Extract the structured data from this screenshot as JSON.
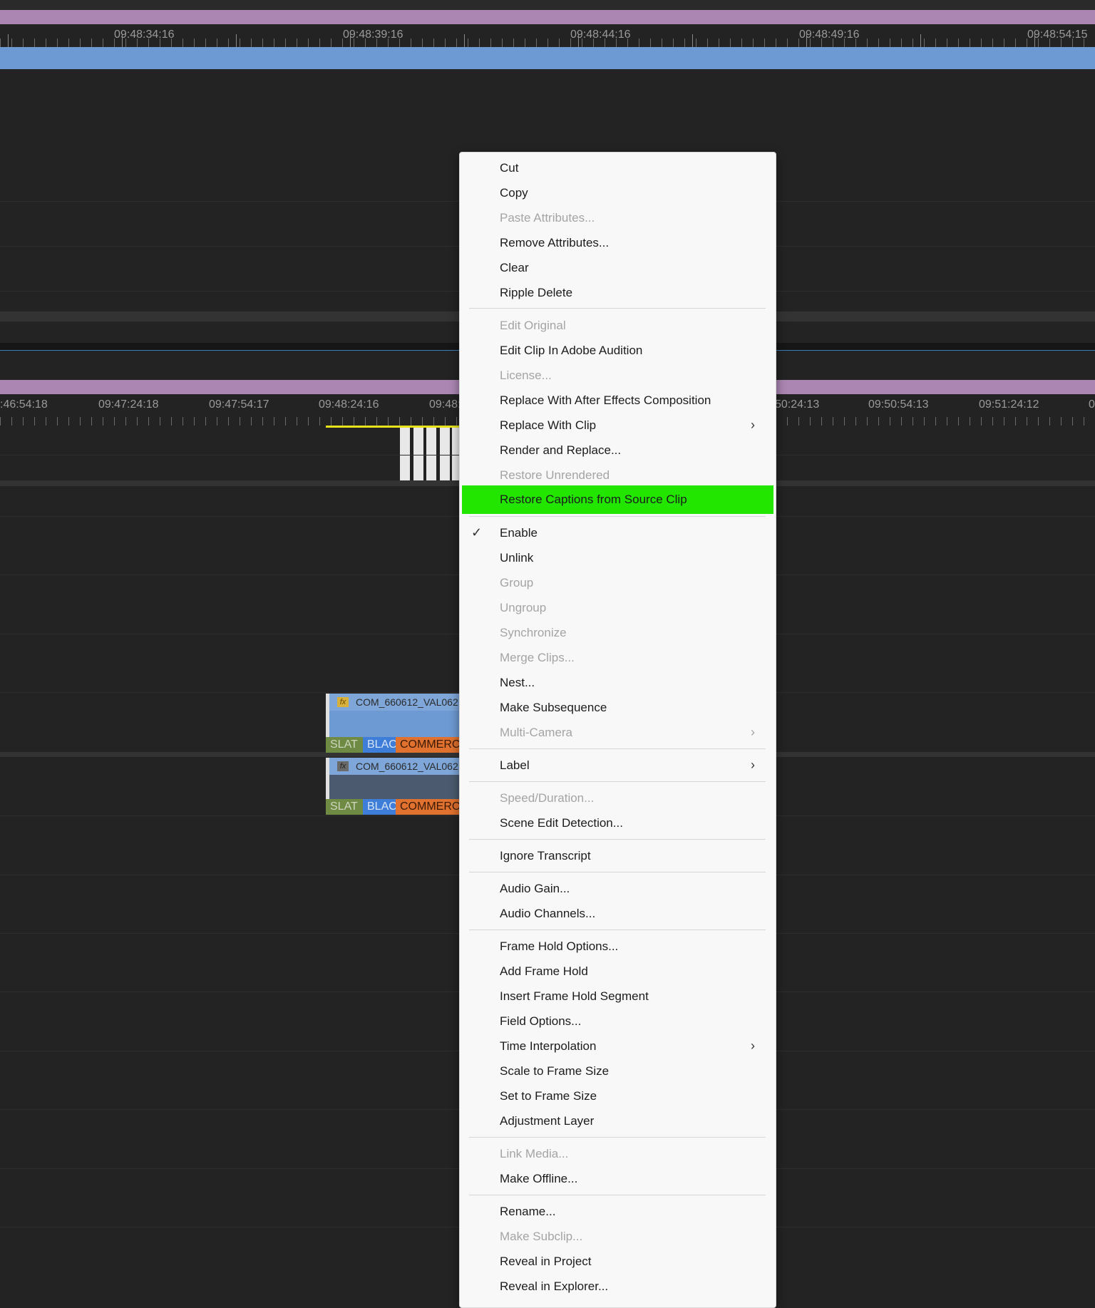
{
  "timeline_top": {
    "timecodes": [
      "09:48:34:16",
      "09:48:39:16",
      "09:48:44:16",
      "09:48:49:16",
      "09:48:54:15"
    ]
  },
  "timeline_bottom": {
    "timecodes": [
      ":46:54:18",
      "09:47:24:18",
      "09:47:54:17",
      "09:48:24:16",
      "09:48:",
      "50:24:13",
      "09:50:54:13",
      "09:51:24:12",
      "0"
    ]
  },
  "clips": {
    "video": {
      "fx_label": "fx",
      "name": "COM_660612_VAL062",
      "markers": [
        "SLAT",
        "BLAC",
        "COMMERC"
      ]
    },
    "audio": {
      "fx_label": "fx",
      "name": "COM_660612_VAL062",
      "markers": [
        "SLAT",
        "BLAC",
        "COMMERC"
      ]
    }
  },
  "colors": {
    "highlight": "#22e500",
    "purple_bar": "#ab86b2",
    "blue_bar": "#6d9ad2",
    "marker_green": "#6e8a43",
    "marker_blue": "#3f7ed8",
    "marker_orange": "#e0712e"
  },
  "menu": {
    "check_icon": "checkmark-icon",
    "submenu_icon": "chevron-right-icon",
    "items": [
      {
        "label": "Cut"
      },
      {
        "label": "Copy"
      },
      {
        "label": "Paste Attributes..."
      },
      {
        "label": "Remove Attributes..."
      },
      {
        "label": "Clear"
      },
      {
        "label": "Ripple Delete"
      },
      {
        "label": "Edit Original"
      },
      {
        "label": "Edit Clip In Adobe Audition"
      },
      {
        "label": "License..."
      },
      {
        "label": "Replace With After Effects Composition"
      },
      {
        "label": "Replace With Clip"
      },
      {
        "label": "Render and Replace..."
      },
      {
        "label": "Restore Unrendered"
      },
      {
        "label": "Restore Captions from Source Clip"
      },
      {
        "label": "Enable",
        "checked": true
      },
      {
        "label": "Unlink"
      },
      {
        "label": "Group"
      },
      {
        "label": "Ungroup"
      },
      {
        "label": "Synchronize"
      },
      {
        "label": "Merge Clips..."
      },
      {
        "label": "Nest..."
      },
      {
        "label": "Make Subsequence"
      },
      {
        "label": "Multi-Camera"
      },
      {
        "label": "Label"
      },
      {
        "label": "Speed/Duration..."
      },
      {
        "label": "Scene Edit Detection..."
      },
      {
        "label": "Ignore Transcript"
      },
      {
        "label": "Audio Gain..."
      },
      {
        "label": "Audio Channels..."
      },
      {
        "label": "Frame Hold Options..."
      },
      {
        "label": "Add Frame Hold"
      },
      {
        "label": "Insert Frame Hold Segment"
      },
      {
        "label": "Field Options..."
      },
      {
        "label": "Time Interpolation"
      },
      {
        "label": "Scale to Frame Size"
      },
      {
        "label": "Set to Frame Size"
      },
      {
        "label": "Adjustment Layer"
      },
      {
        "label": "Link Media..."
      },
      {
        "label": "Make Offline..."
      },
      {
        "label": "Rename..."
      },
      {
        "label": "Make Subclip..."
      },
      {
        "label": "Reveal in Project"
      },
      {
        "label": "Reveal in Explorer..."
      }
    ]
  }
}
